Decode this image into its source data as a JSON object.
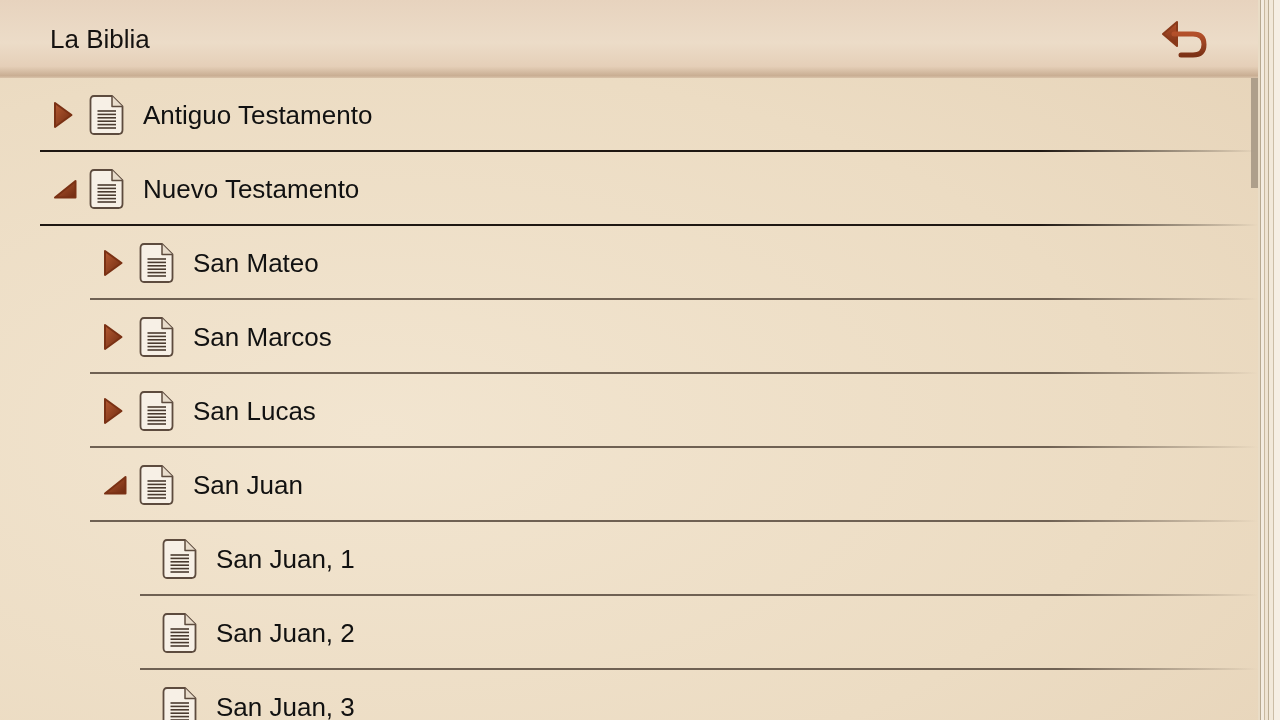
{
  "app_bar": {
    "title": "La Biblia"
  },
  "tree": [
    {
      "label": "Antiguo Testamento",
      "kind": "folder",
      "expanded": false
    },
    {
      "label": "Nuevo Testamento",
      "kind": "folder",
      "expanded": true,
      "children": [
        {
          "label": "San Mateo",
          "kind": "folder",
          "expanded": false
        },
        {
          "label": "San Marcos",
          "kind": "folder",
          "expanded": false
        },
        {
          "label": "San Lucas",
          "kind": "folder",
          "expanded": false
        },
        {
          "label": "San Juan",
          "kind": "folder",
          "expanded": true,
          "children": [
            {
              "label": "San Juan, 1",
              "kind": "leaf"
            },
            {
              "label": "San Juan, 2",
              "kind": "leaf"
            },
            {
              "label": "San Juan, 3",
              "kind": "leaf"
            }
          ]
        }
      ]
    }
  ]
}
